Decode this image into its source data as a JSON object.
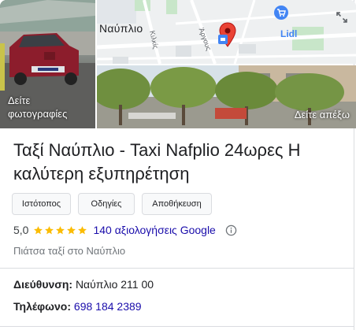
{
  "photos": {
    "car_tile_label": "Δείτε φωτογραφίες",
    "street_tile_label": "Δείτε απέξω"
  },
  "map": {
    "town_label": "Ναύπλιο",
    "store_label": "Lidl",
    "street_label_1": "Κιλκίς",
    "street_label_2": "Άργους",
    "pin_color": "#ea4335",
    "store_color": "#4285f4",
    "expand_icon": "expand-icon"
  },
  "business": {
    "name": "Ταξί Ναύπλιο - Taxi Nafplio 24ωρες Η καλύτερη εξυπηρέτηση",
    "category": "Πιάτσα ταξί στο Ναύπλιο"
  },
  "actions": {
    "website": "Ιστότοπος",
    "directions": "Οδηγίες",
    "save": "Αποθήκευση"
  },
  "rating": {
    "value": "5,0",
    "stars": 5,
    "reviews": "140 αξιολογήσεις Google",
    "star_color": "#fbbc04"
  },
  "details": {
    "address_label": "Διεύθυνση:",
    "address_value": "Ναύπλιο 211 00",
    "phone_label": "Τηλέφωνο:",
    "phone_value": "698 184 2389"
  }
}
